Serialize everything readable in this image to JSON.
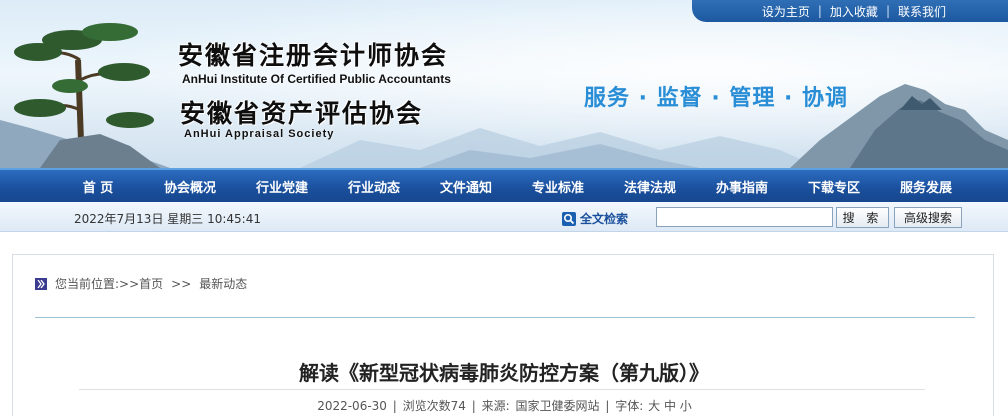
{
  "top_links": [
    "设为主页",
    "加入收藏",
    "联系我们"
  ],
  "top_link_sep": "|",
  "logo": {
    "cn_primary": "安徽省注册会计师协会",
    "en_primary": "AnHui Institute Of Certified Public Accountants",
    "cn_secondary": "安徽省资产评估协会",
    "en_secondary": "AnHui Appraisal Society"
  },
  "slogan": "服务 · 监督 · 管理 · 协调",
  "nav": [
    "首 页",
    "协会概况",
    "行业党建",
    "行业动态",
    "文件通知",
    "专业标准",
    "法律法规",
    "办事指南",
    "下载专区",
    "服务发展"
  ],
  "info_bar": {
    "date": "2022年7月13日 星期三 10:45:41",
    "fulltext_label": "全文检索",
    "search_value": "",
    "search_button": "搜 索",
    "advanced_button": "高级搜索"
  },
  "breadcrumb": {
    "label": "您当前位置:>>",
    "home": "首页",
    "sep": ">>",
    "current": "最新动态"
  },
  "article": {
    "title": "解读《新型冠状病毒肺炎防控方案（第九版）》",
    "date": "2022-06-30",
    "views": "浏览次数74",
    "source_label": "来源:",
    "source": "国家卫健委网站",
    "font_label": "字体:",
    "font_large": "大",
    "font_medium": "中",
    "font_small": "小",
    "sep": "|"
  },
  "colors": {
    "nav_bg": "#1a4f9c",
    "slogan": "#2a8ed6",
    "divider": "#9ec3d6"
  }
}
